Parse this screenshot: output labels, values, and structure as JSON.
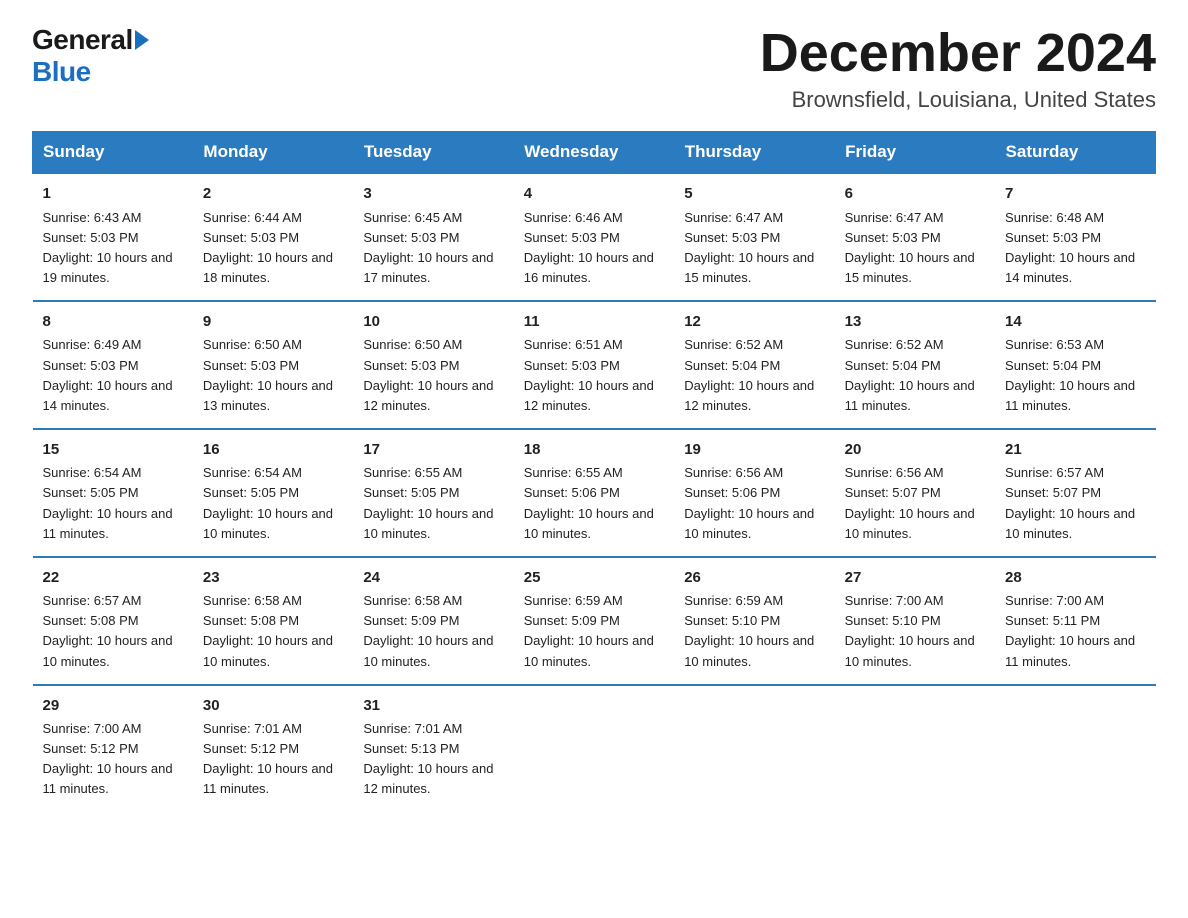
{
  "header": {
    "logo_general": "General",
    "logo_blue": "Blue",
    "month_title": "December 2024",
    "location": "Brownsfield, Louisiana, United States"
  },
  "weekdays": [
    "Sunday",
    "Monday",
    "Tuesday",
    "Wednesday",
    "Thursday",
    "Friday",
    "Saturday"
  ],
  "weeks": [
    [
      {
        "day": "1",
        "sunrise": "Sunrise: 6:43 AM",
        "sunset": "Sunset: 5:03 PM",
        "daylight": "Daylight: 10 hours and 19 minutes."
      },
      {
        "day": "2",
        "sunrise": "Sunrise: 6:44 AM",
        "sunset": "Sunset: 5:03 PM",
        "daylight": "Daylight: 10 hours and 18 minutes."
      },
      {
        "day": "3",
        "sunrise": "Sunrise: 6:45 AM",
        "sunset": "Sunset: 5:03 PM",
        "daylight": "Daylight: 10 hours and 17 minutes."
      },
      {
        "day": "4",
        "sunrise": "Sunrise: 6:46 AM",
        "sunset": "Sunset: 5:03 PM",
        "daylight": "Daylight: 10 hours and 16 minutes."
      },
      {
        "day": "5",
        "sunrise": "Sunrise: 6:47 AM",
        "sunset": "Sunset: 5:03 PM",
        "daylight": "Daylight: 10 hours and 15 minutes."
      },
      {
        "day": "6",
        "sunrise": "Sunrise: 6:47 AM",
        "sunset": "Sunset: 5:03 PM",
        "daylight": "Daylight: 10 hours and 15 minutes."
      },
      {
        "day": "7",
        "sunrise": "Sunrise: 6:48 AM",
        "sunset": "Sunset: 5:03 PM",
        "daylight": "Daylight: 10 hours and 14 minutes."
      }
    ],
    [
      {
        "day": "8",
        "sunrise": "Sunrise: 6:49 AM",
        "sunset": "Sunset: 5:03 PM",
        "daylight": "Daylight: 10 hours and 14 minutes."
      },
      {
        "day": "9",
        "sunrise": "Sunrise: 6:50 AM",
        "sunset": "Sunset: 5:03 PM",
        "daylight": "Daylight: 10 hours and 13 minutes."
      },
      {
        "day": "10",
        "sunrise": "Sunrise: 6:50 AM",
        "sunset": "Sunset: 5:03 PM",
        "daylight": "Daylight: 10 hours and 12 minutes."
      },
      {
        "day": "11",
        "sunrise": "Sunrise: 6:51 AM",
        "sunset": "Sunset: 5:03 PM",
        "daylight": "Daylight: 10 hours and 12 minutes."
      },
      {
        "day": "12",
        "sunrise": "Sunrise: 6:52 AM",
        "sunset": "Sunset: 5:04 PM",
        "daylight": "Daylight: 10 hours and 12 minutes."
      },
      {
        "day": "13",
        "sunrise": "Sunrise: 6:52 AM",
        "sunset": "Sunset: 5:04 PM",
        "daylight": "Daylight: 10 hours and 11 minutes."
      },
      {
        "day": "14",
        "sunrise": "Sunrise: 6:53 AM",
        "sunset": "Sunset: 5:04 PM",
        "daylight": "Daylight: 10 hours and 11 minutes."
      }
    ],
    [
      {
        "day": "15",
        "sunrise": "Sunrise: 6:54 AM",
        "sunset": "Sunset: 5:05 PM",
        "daylight": "Daylight: 10 hours and 11 minutes."
      },
      {
        "day": "16",
        "sunrise": "Sunrise: 6:54 AM",
        "sunset": "Sunset: 5:05 PM",
        "daylight": "Daylight: 10 hours and 10 minutes."
      },
      {
        "day": "17",
        "sunrise": "Sunrise: 6:55 AM",
        "sunset": "Sunset: 5:05 PM",
        "daylight": "Daylight: 10 hours and 10 minutes."
      },
      {
        "day": "18",
        "sunrise": "Sunrise: 6:55 AM",
        "sunset": "Sunset: 5:06 PM",
        "daylight": "Daylight: 10 hours and 10 minutes."
      },
      {
        "day": "19",
        "sunrise": "Sunrise: 6:56 AM",
        "sunset": "Sunset: 5:06 PM",
        "daylight": "Daylight: 10 hours and 10 minutes."
      },
      {
        "day": "20",
        "sunrise": "Sunrise: 6:56 AM",
        "sunset": "Sunset: 5:07 PM",
        "daylight": "Daylight: 10 hours and 10 minutes."
      },
      {
        "day": "21",
        "sunrise": "Sunrise: 6:57 AM",
        "sunset": "Sunset: 5:07 PM",
        "daylight": "Daylight: 10 hours and 10 minutes."
      }
    ],
    [
      {
        "day": "22",
        "sunrise": "Sunrise: 6:57 AM",
        "sunset": "Sunset: 5:08 PM",
        "daylight": "Daylight: 10 hours and 10 minutes."
      },
      {
        "day": "23",
        "sunrise": "Sunrise: 6:58 AM",
        "sunset": "Sunset: 5:08 PM",
        "daylight": "Daylight: 10 hours and 10 minutes."
      },
      {
        "day": "24",
        "sunrise": "Sunrise: 6:58 AM",
        "sunset": "Sunset: 5:09 PM",
        "daylight": "Daylight: 10 hours and 10 minutes."
      },
      {
        "day": "25",
        "sunrise": "Sunrise: 6:59 AM",
        "sunset": "Sunset: 5:09 PM",
        "daylight": "Daylight: 10 hours and 10 minutes."
      },
      {
        "day": "26",
        "sunrise": "Sunrise: 6:59 AM",
        "sunset": "Sunset: 5:10 PM",
        "daylight": "Daylight: 10 hours and 10 minutes."
      },
      {
        "day": "27",
        "sunrise": "Sunrise: 7:00 AM",
        "sunset": "Sunset: 5:10 PM",
        "daylight": "Daylight: 10 hours and 10 minutes."
      },
      {
        "day": "28",
        "sunrise": "Sunrise: 7:00 AM",
        "sunset": "Sunset: 5:11 PM",
        "daylight": "Daylight: 10 hours and 11 minutes."
      }
    ],
    [
      {
        "day": "29",
        "sunrise": "Sunrise: 7:00 AM",
        "sunset": "Sunset: 5:12 PM",
        "daylight": "Daylight: 10 hours and 11 minutes."
      },
      {
        "day": "30",
        "sunrise": "Sunrise: 7:01 AM",
        "sunset": "Sunset: 5:12 PM",
        "daylight": "Daylight: 10 hours and 11 minutes."
      },
      {
        "day": "31",
        "sunrise": "Sunrise: 7:01 AM",
        "sunset": "Sunset: 5:13 PM",
        "daylight": "Daylight: 10 hours and 12 minutes."
      },
      {
        "day": "",
        "sunrise": "",
        "sunset": "",
        "daylight": ""
      },
      {
        "day": "",
        "sunrise": "",
        "sunset": "",
        "daylight": ""
      },
      {
        "day": "",
        "sunrise": "",
        "sunset": "",
        "daylight": ""
      },
      {
        "day": "",
        "sunrise": "",
        "sunset": "",
        "daylight": ""
      }
    ]
  ]
}
